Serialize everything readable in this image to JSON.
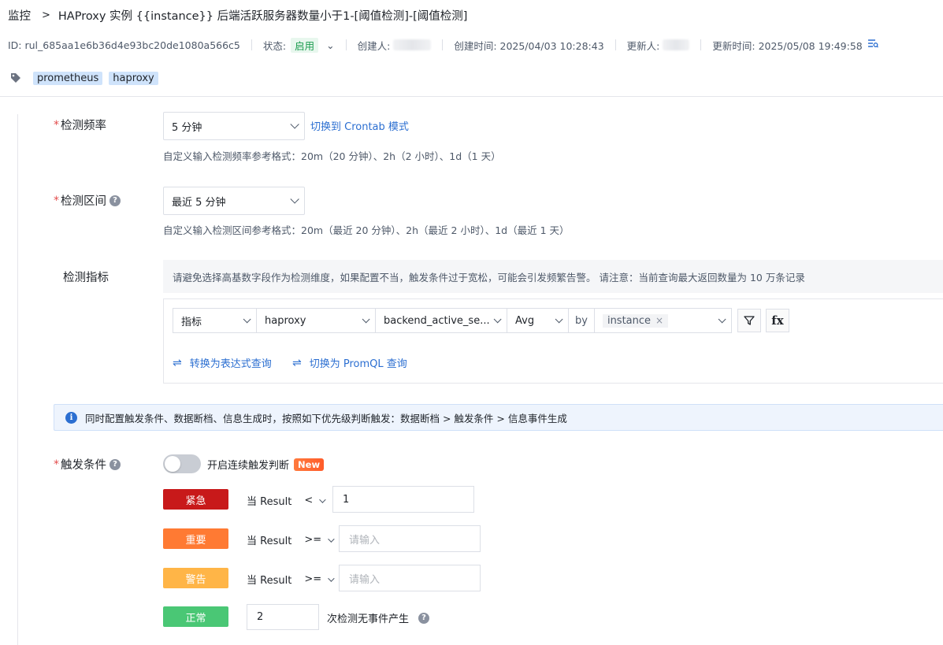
{
  "header": {
    "breadcrumb_root": "监控",
    "title": "HAProxy 实例 {{instance}} 后端活跃服务器数量小于1-[阈值检测]-[阈值检测]"
  },
  "meta": {
    "id_text": "ID: rul_685aa1e6b36d4e93bc20de1080a566c5",
    "status_label": "状态:",
    "status_value": "启用",
    "creator_label": "创建人:",
    "created_time": "创建时间: 2025/04/03 10:28:43",
    "updater_label": "更新人:",
    "updated_time": "更新时间: 2025/05/08 19:49:58"
  },
  "tags": [
    "prometheus",
    "haproxy"
  ],
  "form": {
    "frequency": {
      "label": "检测频率",
      "value": "5 分钟",
      "switch_link": "切换到 Crontab 模式",
      "hint": "自定义输入检测频率参考格式：20m（20 分钟）、2h（2 小时）、1d（1 天）"
    },
    "interval": {
      "label": "检测区间",
      "value": "最近 5 分钟",
      "hint": "自定义输入检测区间参考格式：20m（最近 20 分钟）、2h（最近 2 小时）、1d（最近 1 天）"
    },
    "metric": {
      "label": "检测指标",
      "notice": "请避免选择高基数字段作为检测维度，如果配置不当，触发条件过于宽松，可能会引发频繁告警。 请注意：当前查询最大返回数量为 10 万条记录",
      "type": "指标",
      "source": "haproxy",
      "field": "backend_active_se...",
      "agg": "Avg",
      "by_label": "by",
      "by_chip": "instance",
      "convert_expr": "转换为表达式查询",
      "convert_promql": "切换为 PromQL 查询",
      "fx_label": "fx"
    },
    "info_bar": "同时配置触发条件、数据断档、信息生成时，按照如下优先级判断触发：数据断档 > 触发条件 > 信息事件生成",
    "trigger": {
      "label": "触发条件",
      "switch_label": "开启连续触发判断",
      "new_badge": "New",
      "levels": [
        {
          "name": "紧急",
          "color": "#c8191a",
          "cond": "当 Result",
          "op": "<",
          "value": "1",
          "placeholder": ""
        },
        {
          "name": "重要",
          "color": "#ff7a33",
          "cond": "当 Result",
          "op": ">=",
          "value": "",
          "placeholder": "请输入"
        },
        {
          "name": "警告",
          "color": "#ffb547",
          "cond": "当 Result",
          "op": ">=",
          "value": "",
          "placeholder": "请输入"
        }
      ],
      "normal": {
        "name": "正常",
        "color": "#4ac775",
        "value": "2",
        "suffix": "次检测无事件产生"
      }
    }
  }
}
